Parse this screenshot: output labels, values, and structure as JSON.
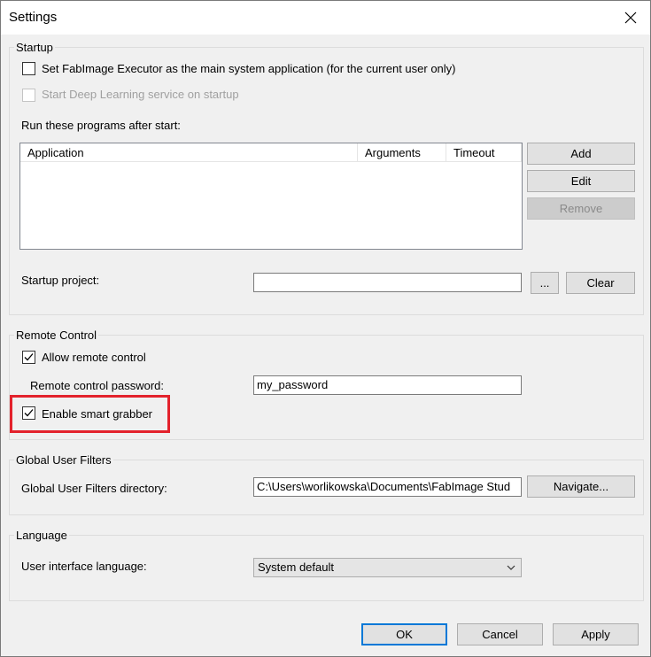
{
  "window": {
    "title": "Settings",
    "close_icon": "close-icon"
  },
  "startup": {
    "group_label": "Startup",
    "main_app_checkbox": {
      "label": "Set FabImage Executor as the main system application (for the current user only)",
      "checked": false
    },
    "deep_learning_checkbox": {
      "label": "Start Deep Learning service on startup",
      "checked": false,
      "enabled": false
    },
    "programs_label": "Run these programs after start:",
    "columns": [
      "Application",
      "Arguments",
      "Timeout"
    ],
    "rows": [],
    "add_label": "Add",
    "edit_label": "Edit",
    "remove_label": "Remove",
    "startup_project_label": "Startup project:",
    "startup_project_value": "",
    "browse_label": "...",
    "clear_label": "Clear"
  },
  "remote_control": {
    "group_label": "Remote Control",
    "allow_checkbox": {
      "label": "Allow remote control",
      "checked": true
    },
    "password_label": "Remote control password:",
    "password_value": "my_password",
    "smart_grabber_checkbox": {
      "label": "Enable smart grabber",
      "checked": true
    }
  },
  "global_user_filters": {
    "group_label": "Global User Filters",
    "directory_label": "Global User Filters directory:",
    "directory_value": "C:\\Users\\worlikowska\\Documents\\FabImage Stud",
    "navigate_label": "Navigate..."
  },
  "language": {
    "group_label": "Language",
    "ui_language_label": "User interface language:",
    "ui_language_value": "System default",
    "dropdown_icon": "chevron-down-icon"
  },
  "footer": {
    "ok_label": "OK",
    "cancel_label": "Cancel",
    "apply_label": "Apply"
  },
  "colors": {
    "highlight": "#e3222c",
    "default_button_border": "#0078d7"
  }
}
